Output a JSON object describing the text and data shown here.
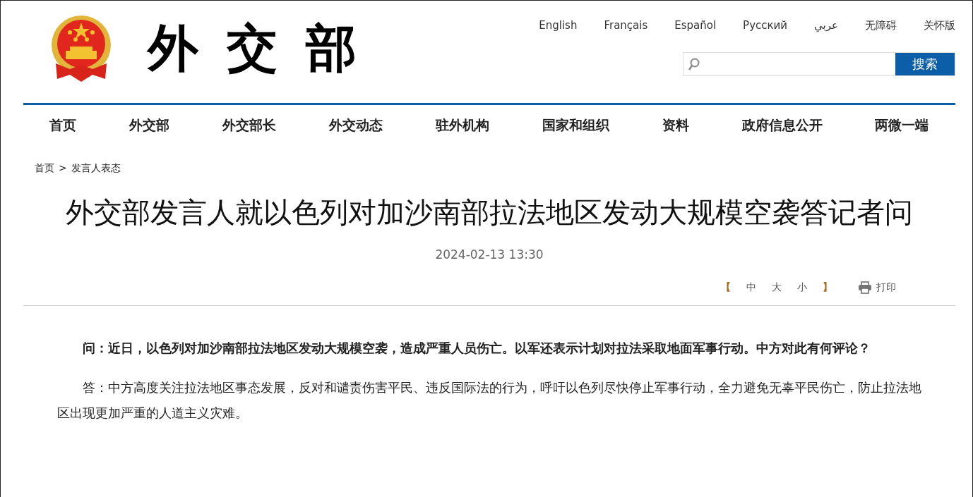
{
  "header": {
    "logo_text": "外交部",
    "languages": [
      "English",
      "Français",
      "Español",
      "Русский",
      "عربي",
      "无障碍",
      "关怀版"
    ],
    "search": {
      "button": "搜索"
    }
  },
  "nav": [
    "首页",
    "外交部",
    "外交部长",
    "外交动态",
    "驻外机构",
    "国家和组织",
    "资料",
    "政府信息公开",
    "两微一端"
  ],
  "breadcrumb": {
    "items": [
      "首页",
      "发言人表态"
    ],
    "separator": ">"
  },
  "article": {
    "title": "外交部发言人就以色列对加沙南部拉法地区发动大规模空袭答记者问",
    "date": "2024-02-13 13:30",
    "font_size": {
      "open": "【",
      "options": [
        "中",
        "大",
        "小"
      ],
      "close": "】"
    },
    "print": "打印",
    "paragraphs": [
      {
        "kind": "question",
        "text": "问：近日，以色列对加沙南部拉法地区发动大规模空袭，造成严重人员伤亡。以军还表示计划对拉法采取地面军事行动。中方对此有何评论？"
      },
      {
        "kind": "answer",
        "text": "答：中方高度关注拉法地区事态发展，反对和谴责伤害平民、违反国际法的行为，呼吁以色列尽快停止军事行动，全力避免无辜平民伤亡，防止拉法地区出现更加严重的人道主义灾难。"
      }
    ]
  }
}
